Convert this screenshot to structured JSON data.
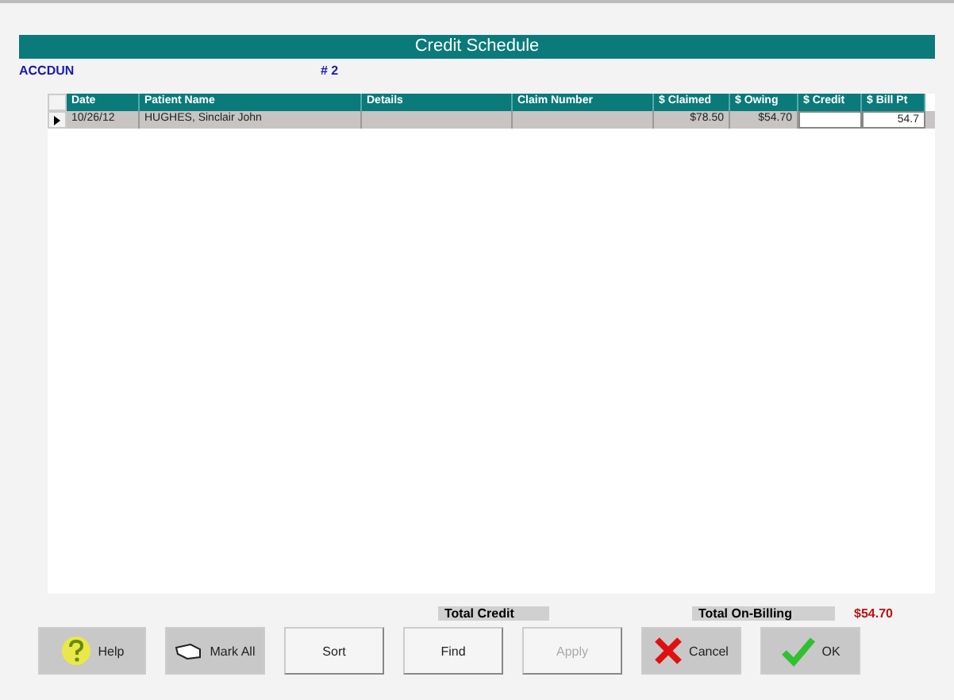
{
  "window": {
    "title": "Credit Schedule"
  },
  "account": {
    "code": "ACCDUN",
    "number": "# 2"
  },
  "table": {
    "columns": [
      "Date",
      "Patient Name",
      "Details",
      "Claim Number",
      "$ Claimed",
      "$ Owing",
      "$ Credit",
      "$ Bill Pt"
    ],
    "rows": [
      {
        "selected": true,
        "cells": [
          "10/26/12",
          "HUGHES, Sinclair John",
          "",
          "",
          "$78.50",
          "$54.70",
          "",
          "54.7"
        ]
      }
    ]
  },
  "totals": [
    {
      "label": "Total Credit"
    },
    {
      "label": "Total On-Billing",
      "value": "$54.70"
    }
  ],
  "buttons": [
    {
      "label": "Help",
      "kind": "help",
      "disabled": false
    },
    {
      "label": "Mark All",
      "kind": "mark",
      "disabled": false
    },
    {
      "label": "Sort",
      "kind": "plain",
      "disabled": false
    },
    {
      "label": "Find",
      "kind": "plain",
      "disabled": false
    },
    {
      "label": "Apply",
      "kind": "plain",
      "disabled": true
    },
    {
      "label": "Cancel",
      "kind": "cancel",
      "disabled": false
    },
    {
      "label": "OK",
      "kind": "ok",
      "disabled": false
    }
  ]
}
